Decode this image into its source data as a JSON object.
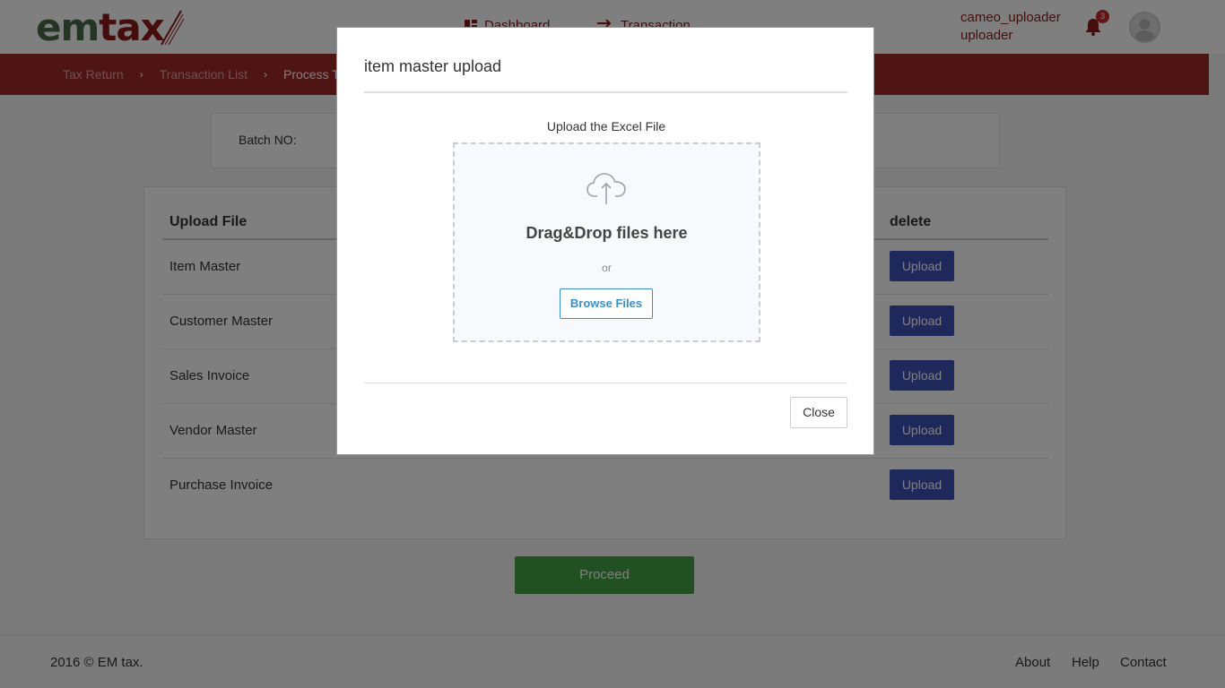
{
  "header": {
    "logo_em": "em",
    "logo_tax": "tax",
    "nav": [
      {
        "label": "Dashboard"
      },
      {
        "label": "Transaction"
      }
    ],
    "username": "cameo_uploader",
    "role": "uploader",
    "notification_count": "3"
  },
  "breadcrumb": {
    "items": [
      "Tax Return",
      "Transaction List",
      "Process Tax"
    ]
  },
  "batch": {
    "label": "Batch NO:"
  },
  "table": {
    "col_file": "Upload File",
    "col_delete": "delete",
    "rows": [
      {
        "name": "Item Master",
        "button": "Upload"
      },
      {
        "name": "Customer Master",
        "button": "Upload"
      },
      {
        "name": "Sales Invoice",
        "button": "Upload"
      },
      {
        "name": "Vendor Master",
        "button": "Upload"
      },
      {
        "name": "Purchase Invoice",
        "button": "Upload"
      }
    ]
  },
  "proceed_label": "Proceed",
  "footer": {
    "copyright": "2016 © EM tax.",
    "links": [
      "About",
      "Help",
      "Contact"
    ]
  },
  "modal": {
    "title": "item master upload",
    "upload_label": "Upload the Excel File",
    "drop_text": "Drag&Drop files here",
    "or_text": "or",
    "browse_label": "Browse Files",
    "close_label": "Close"
  },
  "colors": {
    "brand_red": "#9e2a2a",
    "upload_blue": "#3f51b5",
    "proceed_green": "#43a047",
    "browse_blue": "#3b8fc7"
  }
}
